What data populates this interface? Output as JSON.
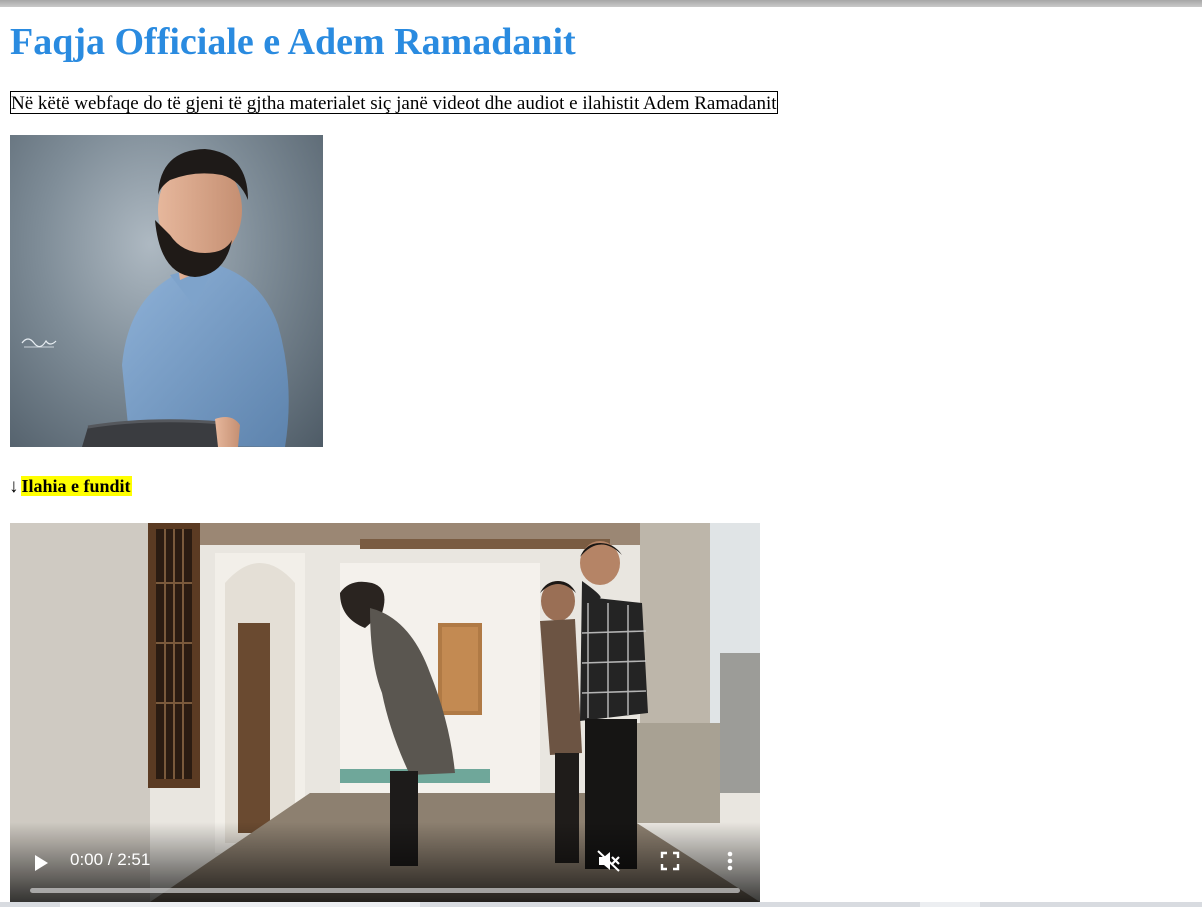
{
  "page": {
    "title": "Faqja Officiale e Adem Ramadanit",
    "intro": "Në këtë webfaqe do të gjeni të gjtha materialet siç janë videot dhe audiot e ilahistit Adem Ramadanit"
  },
  "portrait": {
    "signature_text": "Adem Ramadani"
  },
  "section": {
    "arrow": "↓",
    "label": "Ilahia e fundit"
  },
  "video": {
    "time_display": "0:00 / 2:51",
    "progress": 0,
    "muted": true,
    "icons": {
      "play": "play-icon",
      "mute": "volume-muted-icon",
      "fullscreen": "fullscreen-icon",
      "more": "more-vert-icon"
    }
  },
  "colors": {
    "title": "#2a8be0",
    "highlight": "#ffff00"
  }
}
